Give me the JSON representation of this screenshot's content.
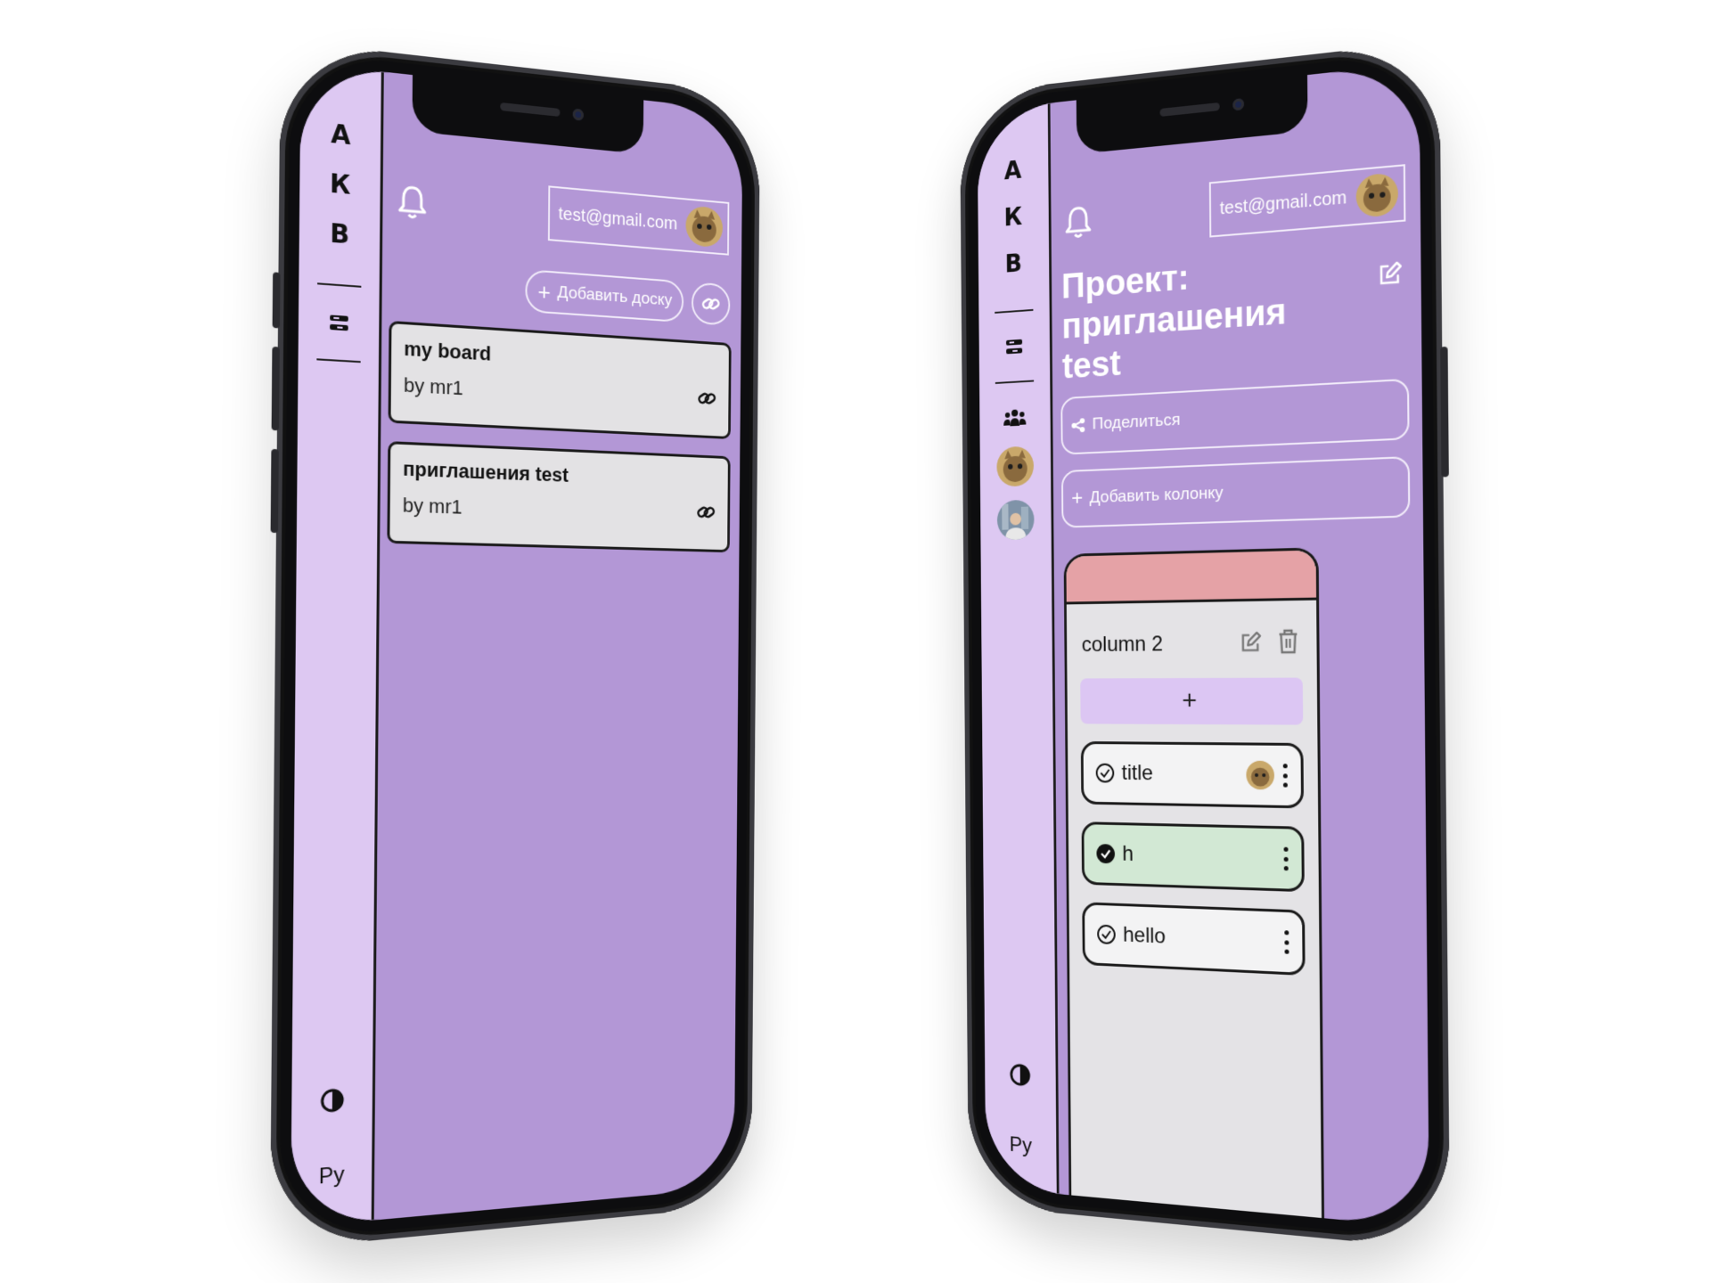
{
  "common": {
    "logo_letters": [
      "А",
      "К",
      "В"
    ],
    "user_email": "test@gmail.com",
    "language": "Ру",
    "accent_color": "#b397d6",
    "rail_color": "#ddc8f2"
  },
  "left_screen": {
    "add_board_label": "Добавить доску",
    "boards": [
      {
        "title": "my board",
        "author": "by mr1"
      },
      {
        "title": "приглашения test",
        "author": "by mr1"
      }
    ]
  },
  "right_screen": {
    "project_title": "Проект: приглашения test",
    "share_label": "Поделиться",
    "add_column_label": "Добавить колонку",
    "column": {
      "title": "column 2",
      "header_color": "#e5a2a6",
      "add_label": "+",
      "tasks": [
        {
          "text": "title",
          "done": false,
          "has_avatar": true
        },
        {
          "text": "h",
          "done": true,
          "has_avatar": false
        },
        {
          "text": "hello",
          "done": false,
          "has_avatar": false
        }
      ]
    }
  },
  "icons": [
    "bell-icon",
    "boards-icon",
    "team-icon",
    "theme-toggle-icon",
    "link-icon",
    "share-icon",
    "edit-icon",
    "trash-icon",
    "check-circle-icon",
    "more-vertical-icon"
  ]
}
